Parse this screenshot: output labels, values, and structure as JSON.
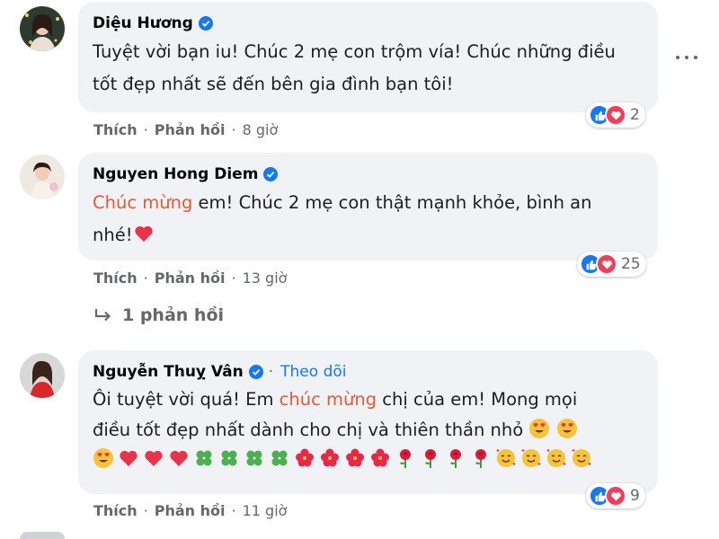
{
  "comments": [
    {
      "author": "Diệu Hương",
      "text": "Tuyệt vời bạn iu! Chúc 2 mẹ con trộm vía! Chúc những điều tốt đẹp nhất sẽ đến bên gia đình bạn tôi!",
      "like_label": "Thích",
      "reply_label": "Phản hồi",
      "time": "8 giờ",
      "reaction_count": "2"
    },
    {
      "author": "Nguyen Hong Diem",
      "text_highlight": "Chúc mừng",
      "text_rest_1": " em! Chúc 2 mẹ con thật mạnh khỏe, bình an",
      "text_rest_2": "nhé!",
      "like_label": "Thích",
      "reply_label": "Phản hồi",
      "time": "13 giờ",
      "reaction_count": "25",
      "replies_label": "1 phản hồi"
    },
    {
      "author": "Nguyễn Thuỵ Vân",
      "follow_label": "Theo dõi",
      "line1_a": "Ôi tuyệt vời quá! Em ",
      "line1_hl": "chúc mừng",
      "line1_b": " chị của em! Mong mọi",
      "line2": "điều tốt đẹp nhất dành cho chị và thiên thần nhỏ",
      "like_label": "Thích",
      "reply_label": "Phản hồi",
      "time": "11 giờ",
      "reaction_count": "9"
    }
  ],
  "icons": {
    "verified": "verified-badge-icon",
    "more": "more-options-icon",
    "reply_arrow": "reply-arrow-icon",
    "like": "like-reaction-icon",
    "love": "love-reaction-icon"
  },
  "colors": {
    "accent": "#1877f2",
    "highlight": "#e35a3a",
    "bubble": "#f0f2f5",
    "meta": "#65676b",
    "love": "#f33e58"
  }
}
